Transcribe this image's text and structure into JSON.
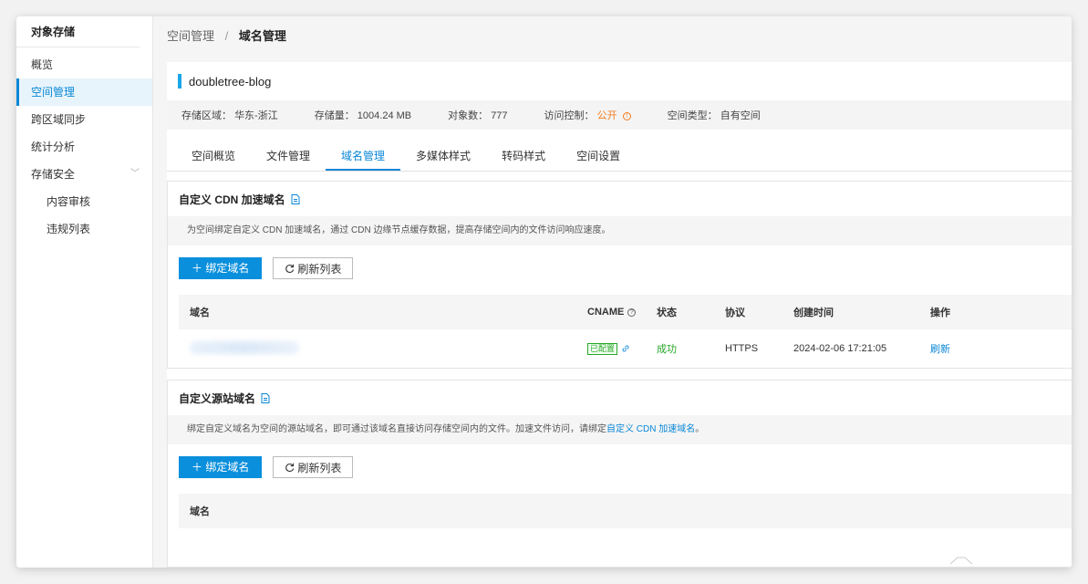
{
  "sidebar": {
    "title": "对象存储",
    "items": [
      {
        "label": "概览"
      },
      {
        "label": "空间管理"
      },
      {
        "label": "跨区域同步"
      },
      {
        "label": "统计分析"
      },
      {
        "label": "存储安全",
        "chevron": "﹀"
      },
      {
        "label": "内容审核"
      },
      {
        "label": "违规列表"
      }
    ]
  },
  "breadcrumb": {
    "parent": "空间管理",
    "separator": "/",
    "current": "域名管理"
  },
  "bucket": {
    "name": "doubletree-blog",
    "info": {
      "region_label": "存储区域：",
      "region_value": "华东-浙江",
      "storage_label": "存储量：",
      "storage_value": "1004.24 MB",
      "objects_label": "对象数：",
      "objects_value": "777",
      "access_label": "访问控制：",
      "access_value": "公开",
      "type_label": "空间类型：",
      "type_value": "自有空间"
    }
  },
  "tabs": [
    {
      "label": "空间概览"
    },
    {
      "label": "文件管理"
    },
    {
      "label": "域名管理"
    },
    {
      "label": "多媒体样式"
    },
    {
      "label": "转码样式"
    },
    {
      "label": "空间设置"
    }
  ],
  "cdn_section": {
    "title": "自定义 CDN 加速域名",
    "description": "为空间绑定自定义 CDN 加速域名，通过 CDN 边缘节点缓存数据，提高存储空间内的文件访问响应速度。",
    "bind_button": "＋ 绑定域名",
    "refresh_button": "刷新列表",
    "columns": {
      "domain": "域名",
      "cname": "CNAME",
      "status": "状态",
      "protocol": "协议",
      "created": "创建时间",
      "action": "操作"
    },
    "rows": [
      {
        "cname_badge": "已配置",
        "status": "成功",
        "protocol": "HTTPS",
        "created": "2024-02-06 17:21:05",
        "action": "刷新"
      }
    ]
  },
  "origin_section": {
    "title": "自定义源站域名",
    "description_prefix": "绑定自定义域名为空间的源站域名，即可通过该域名直接访问存储空间内的文件。加速文件访问，请绑定",
    "description_link": "自定义 CDN 加速域名",
    "description_suffix": "。",
    "bind_button": "＋ 绑定域名",
    "refresh_button": "刷新列表",
    "columns": {
      "domain": "域名"
    }
  },
  "colors": {
    "accent": "#0a87d6",
    "warning": "#f37b1d",
    "success": "#27a727"
  }
}
